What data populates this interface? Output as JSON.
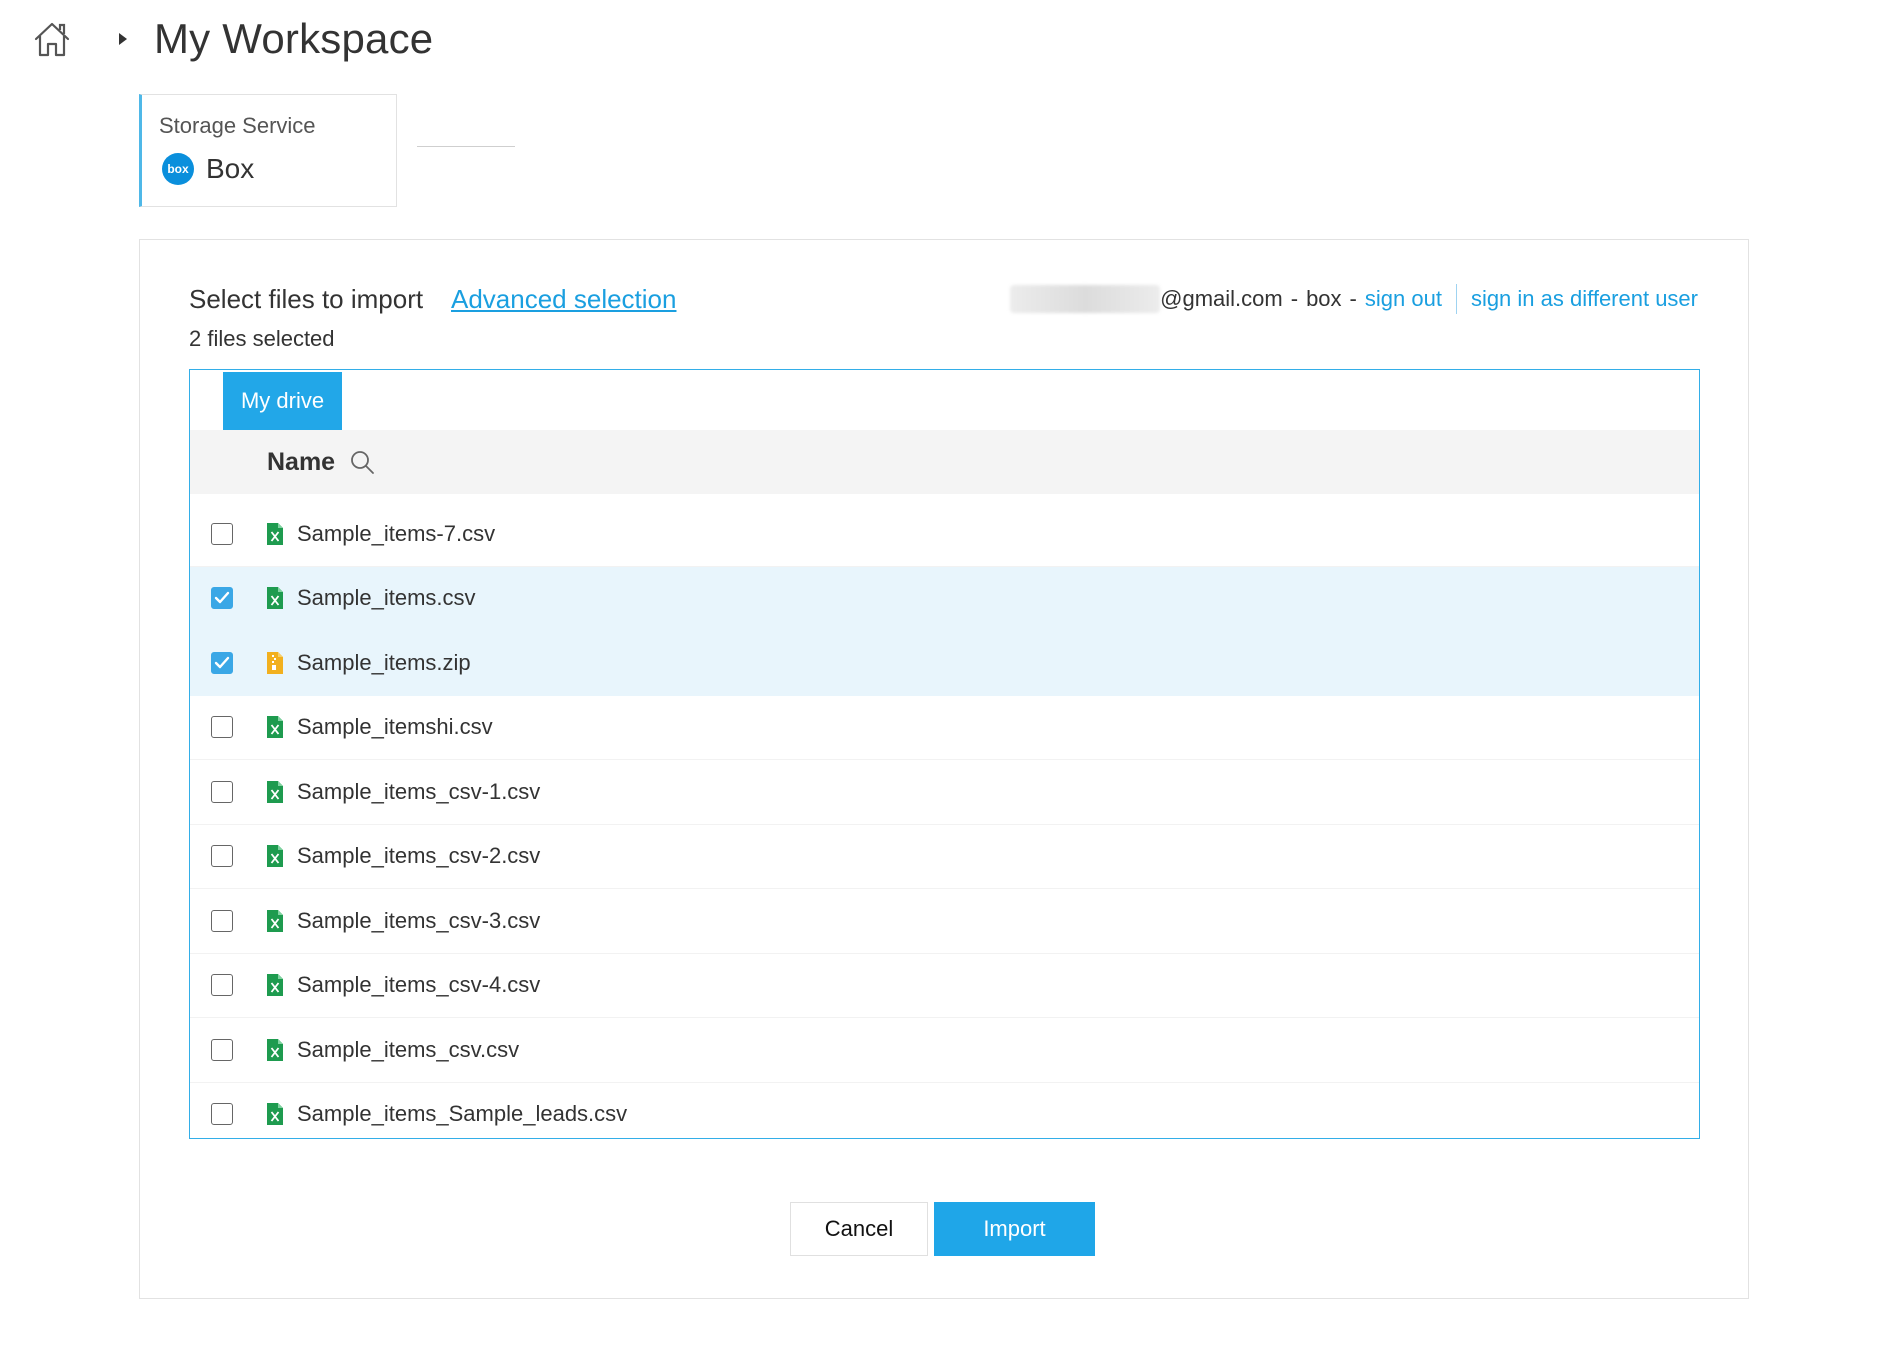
{
  "header": {
    "title": "My Workspace",
    "home_icon": "home-icon",
    "separator_icon": "caret-right-icon"
  },
  "storage": {
    "label": "Storage Service",
    "service_name": "Box",
    "logo_text": "box"
  },
  "panel": {
    "select_label": "Select files to import",
    "advanced_link": "Advanced selection",
    "selected_count": "2 files selected"
  },
  "account": {
    "email_suffix": "@gmail.com",
    "provider": "box",
    "sign_out": "sign out",
    "sign_in_different": "sign in as different user"
  },
  "browser": {
    "tab_label": "My drive",
    "column_name": "Name",
    "files": [
      {
        "name": "Sample_items-7.csv",
        "type": "csv",
        "checked": false
      },
      {
        "name": "Sample_items.csv",
        "type": "csv",
        "checked": true
      },
      {
        "name": "Sample_items.zip",
        "type": "zip",
        "checked": true
      },
      {
        "name": "Sample_itemshi.csv",
        "type": "csv",
        "checked": false
      },
      {
        "name": "Sample_items_csv-1.csv",
        "type": "csv",
        "checked": false
      },
      {
        "name": "Sample_items_csv-2.csv",
        "type": "csv",
        "checked": false
      },
      {
        "name": "Sample_items_csv-3.csv",
        "type": "csv",
        "checked": false
      },
      {
        "name": "Sample_items_csv-4.csv",
        "type": "csv",
        "checked": false
      },
      {
        "name": "Sample_items_csv.csv",
        "type": "csv",
        "checked": false
      },
      {
        "name": "Sample_items_Sample_leads.csv",
        "type": "csv",
        "checked": false
      }
    ]
  },
  "actions": {
    "cancel": "Cancel",
    "import": "Import"
  },
  "colors": {
    "accent": "#1fa6e8",
    "csv_icon": "#1e9b4f",
    "zip_icon": "#f2b01e",
    "selected_row": "#e8f5fc"
  }
}
